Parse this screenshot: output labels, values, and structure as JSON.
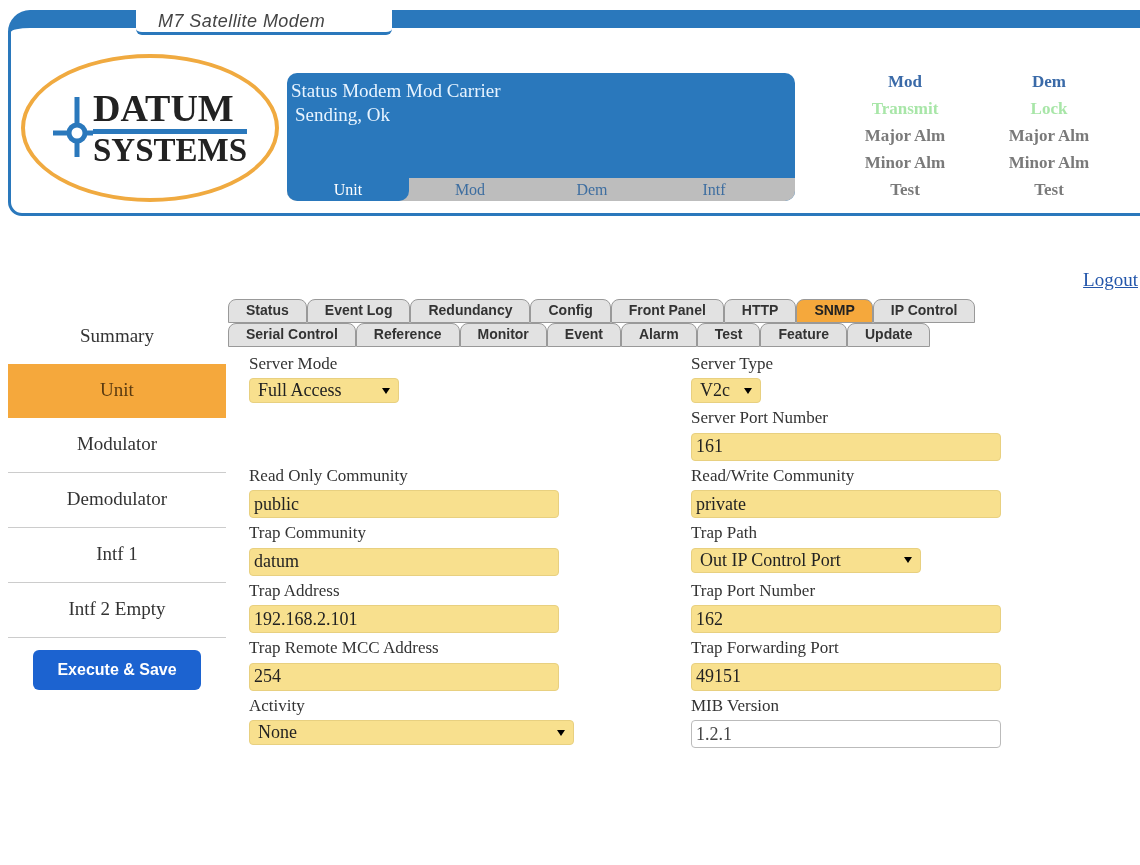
{
  "header": {
    "title": "M7 Satellite Modem",
    "logo": {
      "line1": "DATUM",
      "line2": "SYSTEMS"
    },
    "status": {
      "lines": [
        "Status Modem Mod Carrier",
        "Sending, Ok"
      ],
      "tabs": [
        {
          "label": "Unit",
          "selected": true
        },
        {
          "label": "Mod",
          "selected": false
        },
        {
          "label": "Dem",
          "selected": false
        },
        {
          "label": "Intf",
          "selected": false
        }
      ]
    },
    "indicators": [
      {
        "heading": "Mod",
        "items": [
          {
            "label": "Transmit",
            "on": true
          },
          {
            "label": "Major Alm",
            "on": false
          },
          {
            "label": "Minor Alm",
            "on": false
          },
          {
            "label": "Test",
            "on": false
          }
        ]
      },
      {
        "heading": "Dem",
        "items": [
          {
            "label": "Lock",
            "on": true
          },
          {
            "label": "Major Alm",
            "on": false
          },
          {
            "label": "Minor Alm",
            "on": false
          },
          {
            "label": "Test",
            "on": false
          }
        ]
      }
    ]
  },
  "logout": "Logout",
  "sidebar": {
    "items": [
      {
        "label": "Summary",
        "selected": false
      },
      {
        "label": "Unit",
        "selected": true
      },
      {
        "label": "Modulator",
        "selected": false
      },
      {
        "label": "Demodulator",
        "selected": false
      },
      {
        "label": "Intf 1",
        "selected": false
      },
      {
        "label": "Intf 2 Empty",
        "selected": false
      }
    ],
    "button": "Execute & Save"
  },
  "tab_rows": [
    [
      {
        "label": "Status",
        "selected": false
      },
      {
        "label": "Event Log",
        "selected": false
      },
      {
        "label": "Redundancy",
        "selected": false
      },
      {
        "label": "Config",
        "selected": false
      },
      {
        "label": "Front Panel",
        "selected": false
      },
      {
        "label": "HTTP",
        "selected": false
      },
      {
        "label": "SNMP",
        "selected": true
      },
      {
        "label": "IP Control",
        "selected": false
      }
    ],
    [
      {
        "label": "Serial Control",
        "selected": false
      },
      {
        "label": "Reference",
        "selected": false
      },
      {
        "label": "Monitor",
        "selected": false
      },
      {
        "label": "Event",
        "selected": false
      },
      {
        "label": "Alarm",
        "selected": false
      },
      {
        "label": "Test",
        "selected": false
      },
      {
        "label": "Feature",
        "selected": false
      },
      {
        "label": "Update",
        "selected": false
      }
    ]
  ],
  "form": {
    "rows": [
      {
        "left": {
          "label": "Server Mode",
          "kind": "select",
          "value": "Full Access"
        },
        "right": {
          "label": "Server Type",
          "kind": "select",
          "value": "V2c"
        }
      },
      {
        "right": {
          "label": "Server Port Number",
          "kind": "text",
          "value": "161"
        }
      },
      {
        "left": {
          "label": "Read Only Community",
          "kind": "text",
          "value": "public"
        },
        "right": {
          "label": "Read/Write Community",
          "kind": "text",
          "value": "private"
        }
      },
      {
        "left": {
          "label": "Trap Community",
          "kind": "text",
          "value": "datum"
        },
        "right": {
          "label": "Trap Path",
          "kind": "select",
          "value": "Out IP Control Port"
        }
      },
      {
        "left": {
          "label": "Trap Address",
          "kind": "text",
          "value": "192.168.2.101"
        },
        "right": {
          "label": "Trap Port Number",
          "kind": "text",
          "value": "162"
        }
      },
      {
        "left": {
          "label": "Trap Remote MCC Address",
          "kind": "text",
          "value": "254"
        },
        "right": {
          "label": "Trap Forwarding Port",
          "kind": "text",
          "value": "49151"
        }
      },
      {
        "left": {
          "label": "Activity",
          "kind": "wide_select",
          "value": "None"
        },
        "right": {
          "label": "MIB Version",
          "kind": "readonly",
          "value": "1.2.1"
        }
      }
    ]
  }
}
